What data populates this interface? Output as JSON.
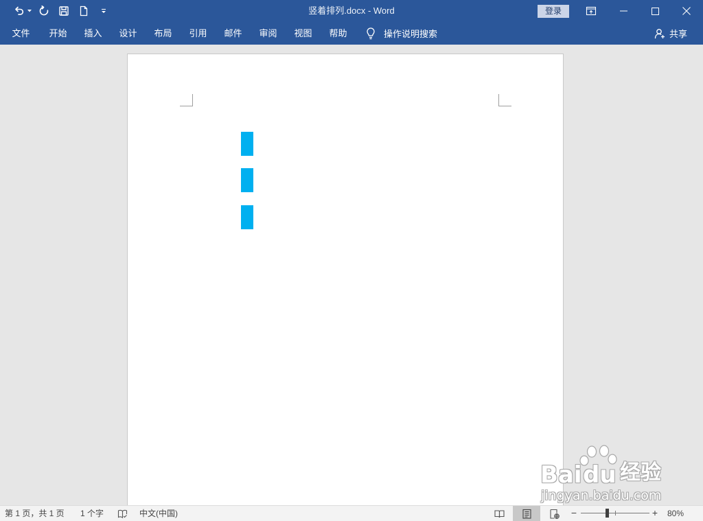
{
  "window": {
    "title": "竖着排列.docx - Word",
    "sign_in_label": "登录",
    "controls": [
      "ribbon-display-options-icon",
      "minimize-icon",
      "maximize-icon",
      "close-icon"
    ]
  },
  "quick_access_toolbar": [
    "undo-icon",
    "undo-dropdown-icon",
    "repeat-icon",
    "save-icon",
    "new-document-icon",
    "customize-toolbar-icon"
  ],
  "ribbon": {
    "tabs": [
      {
        "label": "文件"
      },
      {
        "label": "开始"
      },
      {
        "label": "插入"
      },
      {
        "label": "设计"
      },
      {
        "label": "布局"
      },
      {
        "label": "引用"
      },
      {
        "label": "邮件"
      },
      {
        "label": "审阅"
      },
      {
        "label": "视图"
      },
      {
        "label": "帮助"
      }
    ],
    "tell_me": {
      "icon": "lightbulb-icon",
      "label": "操作说明搜索"
    },
    "share": {
      "icon": "share-person-icon",
      "label": "共享"
    }
  },
  "document": {
    "shading_color": "#00b0f0"
  },
  "status_bar": {
    "page_info": "第 1 页，共 1 页",
    "word_count": "1 个字",
    "proofing_icon": "proofing-book-icon",
    "language": "中文(中国)",
    "views": [
      {
        "icon": "read-mode-icon",
        "active": false
      },
      {
        "icon": "print-layout-icon",
        "active": true
      },
      {
        "icon": "web-layout-icon",
        "active": false
      }
    ],
    "zoom": {
      "out_label": "−",
      "in_label": "+",
      "level_label": "80%",
      "level": 80
    }
  },
  "watermark": {
    "brand": [
      "Bai",
      "du"
    ],
    "product": "经验",
    "url": "jingyan.baidu.com"
  },
  "colors": {
    "accent": "#2b579a",
    "workspace": "#e6e6e6",
    "status_bar": "#f3f3f3"
  }
}
